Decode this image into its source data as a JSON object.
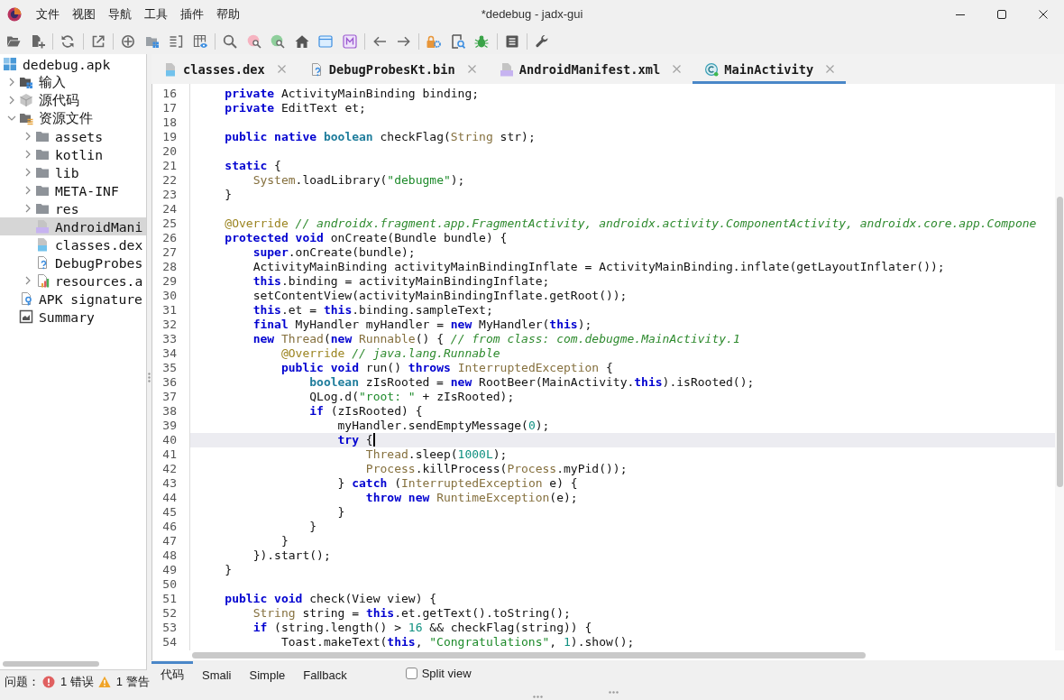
{
  "window": {
    "title": "*dedebug - jadx-gui"
  },
  "menu": [
    "文件",
    "视图",
    "导航",
    "工具",
    "插件",
    "帮助"
  ],
  "tree": {
    "items": [
      {
        "label": "dedebug.apk",
        "kind": "apk",
        "selected": false,
        "children": [
          {
            "label": "输入",
            "kind": "input",
            "expanded": false,
            "selected": false
          },
          {
            "label": "源代码",
            "kind": "source",
            "expanded": false,
            "selected": false
          },
          {
            "label": "资源文件",
            "kind": "resources",
            "expanded": true,
            "selected": false,
            "children": [
              {
                "label": "assets",
                "kind": "folder",
                "expanded": false,
                "selected": false
              },
              {
                "label": "kotlin",
                "kind": "folder",
                "expanded": false,
                "selected": false
              },
              {
                "label": "lib",
                "kind": "folder",
                "expanded": false,
                "selected": false
              },
              {
                "label": "META-INF",
                "kind": "folder",
                "expanded": false,
                "selected": false
              },
              {
                "label": "res",
                "kind": "folder",
                "expanded": false,
                "selected": false
              },
              {
                "label": "AndroidMani",
                "kind": "manifest",
                "selected": true
              },
              {
                "label": "classes.dex",
                "kind": "dex",
                "selected": false
              },
              {
                "label": "DebugProbes",
                "kind": "unknown",
                "selected": false
              },
              {
                "label": "resources.a",
                "kind": "arsc",
                "expanded": false,
                "selected": false
              }
            ]
          },
          {
            "label": "APK signature",
            "kind": "signature",
            "selected": false
          },
          {
            "label": "Summary",
            "kind": "summary",
            "selected": false
          }
        ]
      }
    ]
  },
  "problems": {
    "label": "问题：",
    "errors": "1 错误",
    "warnings": "1 警告"
  },
  "editor_tabs": [
    {
      "label": "classes.dex",
      "kind": "dex",
      "selected": false
    },
    {
      "label": "DebugProbesKt.bin",
      "kind": "unknown",
      "selected": false
    },
    {
      "label": "AndroidManifest.xml",
      "kind": "manifest",
      "selected": false
    },
    {
      "label": "MainActivity",
      "kind": "class",
      "selected": true
    }
  ],
  "editor": {
    "lines": [
      {
        "number": "16",
        "current": false,
        "tokens": [
          {
            "kind": "keyword",
            "text": "    private"
          },
          {
            "kind": "plain",
            "text": " ActivityMainBinding binding;"
          }
        ]
      },
      {
        "number": "17",
        "current": false,
        "tokens": [
          {
            "kind": "keyword",
            "text": "    private"
          },
          {
            "kind": "plain",
            "text": " EditText et;"
          }
        ]
      },
      {
        "number": "18",
        "current": false
      },
      {
        "number": "19",
        "current": false,
        "tokens": [
          {
            "kind": "keyword",
            "text": "    public "
          },
          {
            "kind": "keyword",
            "text": "native "
          },
          {
            "kind": "primitive",
            "text": "boolean"
          },
          {
            "kind": "plain",
            "text": " checkFlag("
          },
          {
            "kind": "type",
            "text": "String"
          },
          {
            "kind": "plain",
            "text": " str);"
          }
        ]
      },
      {
        "number": "20",
        "current": false
      },
      {
        "number": "21",
        "current": false,
        "tokens": [
          {
            "kind": "keyword",
            "text": "    static"
          },
          {
            "kind": "plain",
            "text": " {"
          }
        ]
      },
      {
        "number": "22",
        "current": false,
        "tokens": [
          {
            "kind": "type",
            "text": "        System"
          },
          {
            "kind": "plain",
            "text": ".loadLibrary("
          },
          {
            "kind": "string",
            "text": "\"debugme\""
          },
          {
            "kind": "plain",
            "text": ");"
          }
        ]
      },
      {
        "number": "23",
        "current": false,
        "tokens": [
          {
            "kind": "plain",
            "text": "    }"
          }
        ]
      },
      {
        "number": "24",
        "current": false
      },
      {
        "number": "25",
        "current": false,
        "tokens": [
          {
            "kind": "annotation",
            "text": "    @Override "
          },
          {
            "kind": "comment",
            "text": "// androidx.fragment.app.FragmentActivity, androidx.activity.ComponentActivity, androidx.core.app.Compone"
          }
        ]
      },
      {
        "number": "26",
        "current": false,
        "tokens": [
          {
            "kind": "keyword",
            "text": "    protected "
          },
          {
            "kind": "keyword",
            "text": "void"
          },
          {
            "kind": "plain",
            "text": " onCreate(Bundle bundle) {"
          }
        ]
      },
      {
        "number": "27",
        "current": false,
        "tokens": [
          {
            "kind": "keyword",
            "text": "        super"
          },
          {
            "kind": "plain",
            "text": ".onCreate(bundle);"
          }
        ]
      },
      {
        "number": "28",
        "current": false,
        "tokens": [
          {
            "kind": "plain",
            "text": "        ActivityMainBinding activityMainBindingInflate = ActivityMainBinding.inflate(getLayoutInflater());"
          }
        ]
      },
      {
        "number": "29",
        "current": false,
        "tokens": [
          {
            "kind": "keyword",
            "text": "        this"
          },
          {
            "kind": "plain",
            "text": ".binding = activityMainBindingInflate;"
          }
        ]
      },
      {
        "number": "30",
        "current": false,
        "tokens": [
          {
            "kind": "plain",
            "text": "        setContentView(activityMainBindingInflate.getRoot());"
          }
        ]
      },
      {
        "number": "31",
        "current": false,
        "tokens": [
          {
            "kind": "keyword",
            "text": "        this"
          },
          {
            "kind": "plain",
            "text": ".et = "
          },
          {
            "kind": "keyword",
            "text": "this"
          },
          {
            "kind": "plain",
            "text": ".binding.sampleText;"
          }
        ]
      },
      {
        "number": "32",
        "current": false,
        "tokens": [
          {
            "kind": "keyword",
            "text": "        final"
          },
          {
            "kind": "plain",
            "text": " MyHandler myHandler = "
          },
          {
            "kind": "keyword",
            "text": "new"
          },
          {
            "kind": "plain",
            "text": " MyHandler("
          },
          {
            "kind": "keyword",
            "text": "this"
          },
          {
            "kind": "plain",
            "text": ");"
          }
        ]
      },
      {
        "number": "33",
        "current": false,
        "tokens": [
          {
            "kind": "keyword",
            "text": "        new "
          },
          {
            "kind": "type",
            "text": "Thread"
          },
          {
            "kind": "plain",
            "text": "("
          },
          {
            "kind": "keyword",
            "text": "new "
          },
          {
            "kind": "type",
            "text": "Runnable"
          },
          {
            "kind": "plain",
            "text": "() { "
          },
          {
            "kind": "comment",
            "text": "// from class: com.debugme.MainActivity.1"
          }
        ]
      },
      {
        "number": "34",
        "current": false,
        "tokens": [
          {
            "kind": "annotation",
            "text": "            @Override "
          },
          {
            "kind": "comment",
            "text": "// java.lang.Runnable"
          }
        ]
      },
      {
        "number": "35",
        "current": false,
        "tokens": [
          {
            "kind": "keyword",
            "text": "            public "
          },
          {
            "kind": "keyword",
            "text": "void"
          },
          {
            "kind": "plain",
            "text": " run() "
          },
          {
            "kind": "keyword",
            "text": "throws "
          },
          {
            "kind": "type",
            "text": "InterruptedException"
          },
          {
            "kind": "plain",
            "text": " {"
          }
        ]
      },
      {
        "number": "36",
        "current": false,
        "tokens": [
          {
            "kind": "primitive",
            "text": "                boolean"
          },
          {
            "kind": "plain",
            "text": " zIsRooted = "
          },
          {
            "kind": "keyword",
            "text": "new"
          },
          {
            "kind": "plain",
            "text": " RootBeer(MainActivity."
          },
          {
            "kind": "keyword",
            "text": "this"
          },
          {
            "kind": "plain",
            "text": ").isRooted();"
          }
        ]
      },
      {
        "number": "37",
        "current": false,
        "tokens": [
          {
            "kind": "plain",
            "text": "                QLog.d("
          },
          {
            "kind": "string",
            "text": "\"root: \""
          },
          {
            "kind": "plain",
            "text": " + zIsRooted);"
          }
        ]
      },
      {
        "number": "38",
        "current": false,
        "tokens": [
          {
            "kind": "keyword",
            "text": "                if"
          },
          {
            "kind": "plain",
            "text": " (zIsRooted) {"
          }
        ]
      },
      {
        "number": "39",
        "current": false,
        "tokens": [
          {
            "kind": "plain",
            "text": "                    myHandler.sendEmptyMessage("
          },
          {
            "kind": "number",
            "text": "0"
          },
          {
            "kind": "plain",
            "text": ");"
          }
        ]
      },
      {
        "number": "40",
        "current": true,
        "tokens": [
          {
            "kind": "keyword",
            "text": "                    try"
          },
          {
            "kind": "plain",
            "text": " {"
          }
        ]
      },
      {
        "number": "41",
        "current": false,
        "tokens": [
          {
            "kind": "type",
            "text": "                        Thread"
          },
          {
            "kind": "plain",
            "text": ".sleep("
          },
          {
            "kind": "number",
            "text": "1000L"
          },
          {
            "kind": "plain",
            "text": ");"
          }
        ]
      },
      {
        "number": "42",
        "current": false,
        "tokens": [
          {
            "kind": "type",
            "text": "                        Process"
          },
          {
            "kind": "plain",
            "text": ".killProcess("
          },
          {
            "kind": "type",
            "text": "Process"
          },
          {
            "kind": "plain",
            "text": ".myPid());"
          }
        ]
      },
      {
        "number": "43",
        "current": false,
        "tokens": [
          {
            "kind": "plain",
            "text": "                    } "
          },
          {
            "kind": "keyword",
            "text": "catch"
          },
          {
            "kind": "plain",
            "text": " ("
          },
          {
            "kind": "type",
            "text": "InterruptedException"
          },
          {
            "kind": "plain",
            "text": " e) {"
          }
        ]
      },
      {
        "number": "44",
        "current": false,
        "tokens": [
          {
            "kind": "keyword",
            "text": "                        throw "
          },
          {
            "kind": "keyword",
            "text": "new "
          },
          {
            "kind": "type",
            "text": "RuntimeException"
          },
          {
            "kind": "plain",
            "text": "(e);"
          }
        ]
      },
      {
        "number": "45",
        "current": false,
        "tokens": [
          {
            "kind": "plain",
            "text": "                    }"
          }
        ]
      },
      {
        "number": "46",
        "current": false,
        "tokens": [
          {
            "kind": "plain",
            "text": "                }"
          }
        ]
      },
      {
        "number": "47",
        "current": false,
        "tokens": [
          {
            "kind": "plain",
            "text": "            }"
          }
        ]
      },
      {
        "number": "48",
        "current": false,
        "tokens": [
          {
            "kind": "plain",
            "text": "        }).start();"
          }
        ]
      },
      {
        "number": "49",
        "current": false,
        "tokens": [
          {
            "kind": "plain",
            "text": "    }"
          }
        ]
      },
      {
        "number": "50",
        "current": false
      },
      {
        "number": "51",
        "current": false,
        "tokens": [
          {
            "kind": "keyword",
            "text": "    public "
          },
          {
            "kind": "keyword",
            "text": "void"
          },
          {
            "kind": "plain",
            "text": " check(View view) {"
          }
        ]
      },
      {
        "number": "52",
        "current": false,
        "tokens": [
          {
            "kind": "type",
            "text": "        String"
          },
          {
            "kind": "plain",
            "text": " string = "
          },
          {
            "kind": "keyword",
            "text": "this"
          },
          {
            "kind": "plain",
            "text": ".et.getText().toString();"
          }
        ]
      },
      {
        "number": "53",
        "current": false,
        "tokens": [
          {
            "kind": "keyword",
            "text": "        if"
          },
          {
            "kind": "plain",
            "text": " (string.length() > "
          },
          {
            "kind": "number",
            "text": "16"
          },
          {
            "kind": "plain",
            "text": " && checkFlag(string)) {"
          }
        ]
      },
      {
        "number": "54",
        "current": false,
        "tokens": [
          {
            "kind": "plain",
            "text": "            Toast.makeText("
          },
          {
            "kind": "keyword",
            "text": "this"
          },
          {
            "kind": "plain",
            "text": ", "
          },
          {
            "kind": "string",
            "text": "\"Congratulations\""
          },
          {
            "kind": "plain",
            "text": ", "
          },
          {
            "kind": "number",
            "text": "1"
          },
          {
            "kind": "plain",
            "text": ").show();"
          }
        ]
      }
    ]
  },
  "code_view": {
    "tabs": [
      {
        "label": "代码",
        "selected": true
      },
      {
        "label": "Smali",
        "selected": false
      },
      {
        "label": "Simple",
        "selected": false
      },
      {
        "label": "Fallback",
        "selected": false
      }
    ],
    "split_view": {
      "label": "Split view",
      "checked": false
    }
  }
}
